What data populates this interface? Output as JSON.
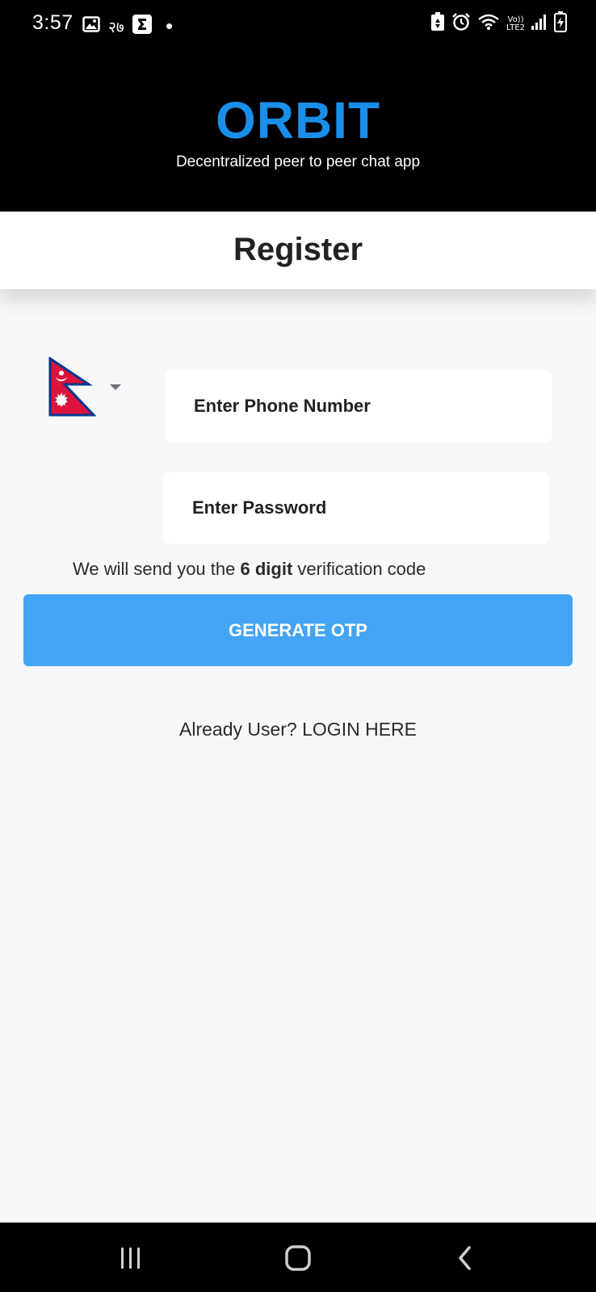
{
  "status_bar": {
    "time": "3:57",
    "notification_digits": "२७",
    "network_line1": "Vo))",
    "network_line2": "LTE2",
    "icons": [
      "image-icon",
      "sigma-icon",
      "dot-icon",
      "battery-saver-icon",
      "alarm-icon",
      "wifi-icon",
      "signal-icon",
      "battery-charging-icon"
    ]
  },
  "header": {
    "brand": "ORBIT",
    "tagline": "Decentralized peer to peer chat app",
    "brand_color": "#1a8fea"
  },
  "page": {
    "title": "Register"
  },
  "form": {
    "country_flag": "nepal-flag-icon",
    "phone": {
      "placeholder": "Enter Phone Number",
      "value": ""
    },
    "password": {
      "placeholder": "Enter Password",
      "value": ""
    },
    "note_prefix": "We will send you the",
    "note_bold": "6 digit",
    "note_suffix": "verification code",
    "generate_button": "GENERATE OTP",
    "button_color": "#44a4f5",
    "login_link": "Already User? LOGIN HERE"
  },
  "nav": {
    "icons": [
      "recent-apps-icon",
      "home-icon",
      "back-icon"
    ]
  }
}
